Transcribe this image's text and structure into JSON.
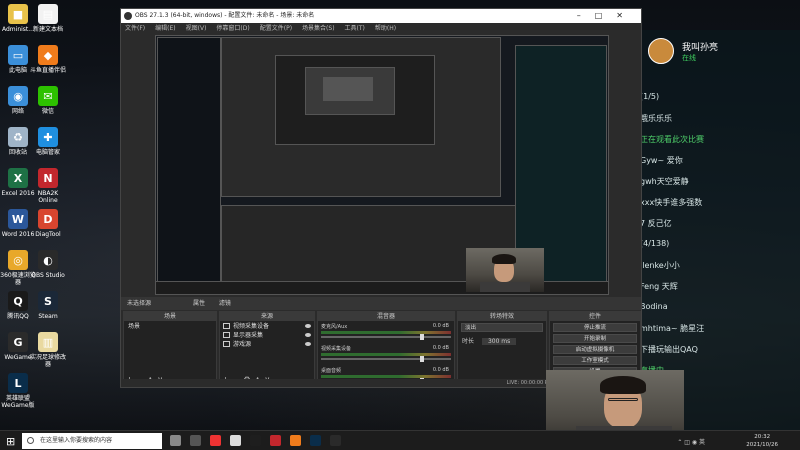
{
  "desktop_icons": [
    {
      "label": "Administ...",
      "color": "#e8c24a",
      "glyph": "■"
    },
    {
      "label": "新建文本档",
      "color": "#f2f2f2",
      "glyph": "▤"
    },
    {
      "label": "此电脑",
      "color": "#3b8fd9",
      "glyph": "▭"
    },
    {
      "label": "斗鱼直播伴侣",
      "color": "#f07c1c",
      "glyph": "◆"
    },
    {
      "label": "网络",
      "color": "#3b8fd9",
      "glyph": "◉"
    },
    {
      "label": "微信",
      "color": "#2dc100",
      "glyph": "✉"
    },
    {
      "label": "回收站",
      "color": "#9fb4c8",
      "glyph": "♻"
    },
    {
      "label": "电脑管家",
      "color": "#1f8fe0",
      "glyph": "✚"
    },
    {
      "label": "Excel 2016",
      "color": "#1e7145",
      "glyph": "X"
    },
    {
      "label": "NBA2K Online",
      "color": "#c2272d",
      "glyph": "N"
    },
    {
      "label": "Word 2016",
      "color": "#2b579a",
      "glyph": "W"
    },
    {
      "label": "DiagTool",
      "color": "#d8452f",
      "glyph": "D"
    },
    {
      "label": "360极速浏览器",
      "color": "#e8a82a",
      "glyph": "◎"
    },
    {
      "label": "OBS Studio",
      "color": "#2a2a2a",
      "glyph": "◐"
    },
    {
      "label": "腾讯QQ",
      "color": "#1a1a1a",
      "glyph": "Q"
    },
    {
      "label": "Steam",
      "color": "#1b2838",
      "glyph": "S"
    },
    {
      "label": "WeGame",
      "color": "#2b2b2b",
      "glyph": "G"
    },
    {
      "label": "实况足球修改器",
      "color": "#e9d9a0",
      "glyph": "▥"
    },
    {
      "label": "英雄联盟 WeGame版",
      "color": "#0a2d4a",
      "glyph": "L"
    }
  ],
  "chat_panel": {
    "streamer_name": "我叫孙亮",
    "status": "在线",
    "lines": [
      {
        "text": "(1/5)",
        "style": "white"
      },
      {
        "text": "哦乐乐乐",
        "style": "white"
      },
      {
        "text": "正在观看此次比赛",
        "style": "green"
      },
      {
        "text": "Gyw~ 爱你",
        "style": "white"
      },
      {
        "text": "gwh天空爱静",
        "style": "white"
      },
      {
        "text": "xxx快手谁多强数",
        "style": "white"
      },
      {
        "text": "7 反己亿",
        "style": "white"
      },
      {
        "text": "(4/138)",
        "style": "white"
      },
      {
        "text": "ilenke小小",
        "style": "white"
      },
      {
        "text": "Feng 天辉",
        "style": "white"
      },
      {
        "text": "Bodina",
        "style": "white"
      },
      {
        "text": "mhtima~ 脆星汪",
        "style": "white"
      },
      {
        "text": "下播玩输出QAQ",
        "style": "white"
      },
      {
        "text": "直播中",
        "style": "green"
      }
    ]
  },
  "obs": {
    "title": "OBS 27.1.3 (64-bit, windows) - 配置文件: 未命名 - 场景: 未命名",
    "menu": [
      "文件(F)",
      "编辑(E)",
      "视图(V)",
      "停靠窗口(D)",
      "配置文件(P)",
      "场景集合(S)",
      "工具(T)",
      "帮助(H)"
    ],
    "scene_bar": {
      "label": "未选择源",
      "properties": "属性",
      "filters": "滤镜"
    },
    "docks": {
      "scenes": {
        "title": "场景",
        "items": [
          "场景"
        ]
      },
      "sources": {
        "title": "来源",
        "items": [
          "视频采集设备",
          "显示器采集",
          "游戏源"
        ]
      },
      "mixer": {
        "title": "混音器",
        "channels": [
          {
            "name": "麦克风/Aux",
            "db": "0.0 dB"
          },
          {
            "name": "视频采集设备",
            "db": "0.0 dB"
          },
          {
            "name": "桌面音频",
            "db": "0.0 dB"
          }
        ]
      },
      "transitions": {
        "title": "转场特效",
        "type": "淡出",
        "duration_label": "时长",
        "duration": "300 ms"
      },
      "controls": {
        "title": "控件",
        "buttons": [
          "停止推流",
          "开始录制",
          "启动虚拟摄像机",
          "工作室模式",
          "设置",
          "退出"
        ]
      }
    },
    "status": "LIVE: 00:00:00   REC: 00:00:00   CPU: 3.2%, 30.00 fps"
  },
  "taskbar": {
    "search_placeholder": "在这里输入你要搜索的内容",
    "time": "20:32",
    "date": "2021/10/26"
  }
}
